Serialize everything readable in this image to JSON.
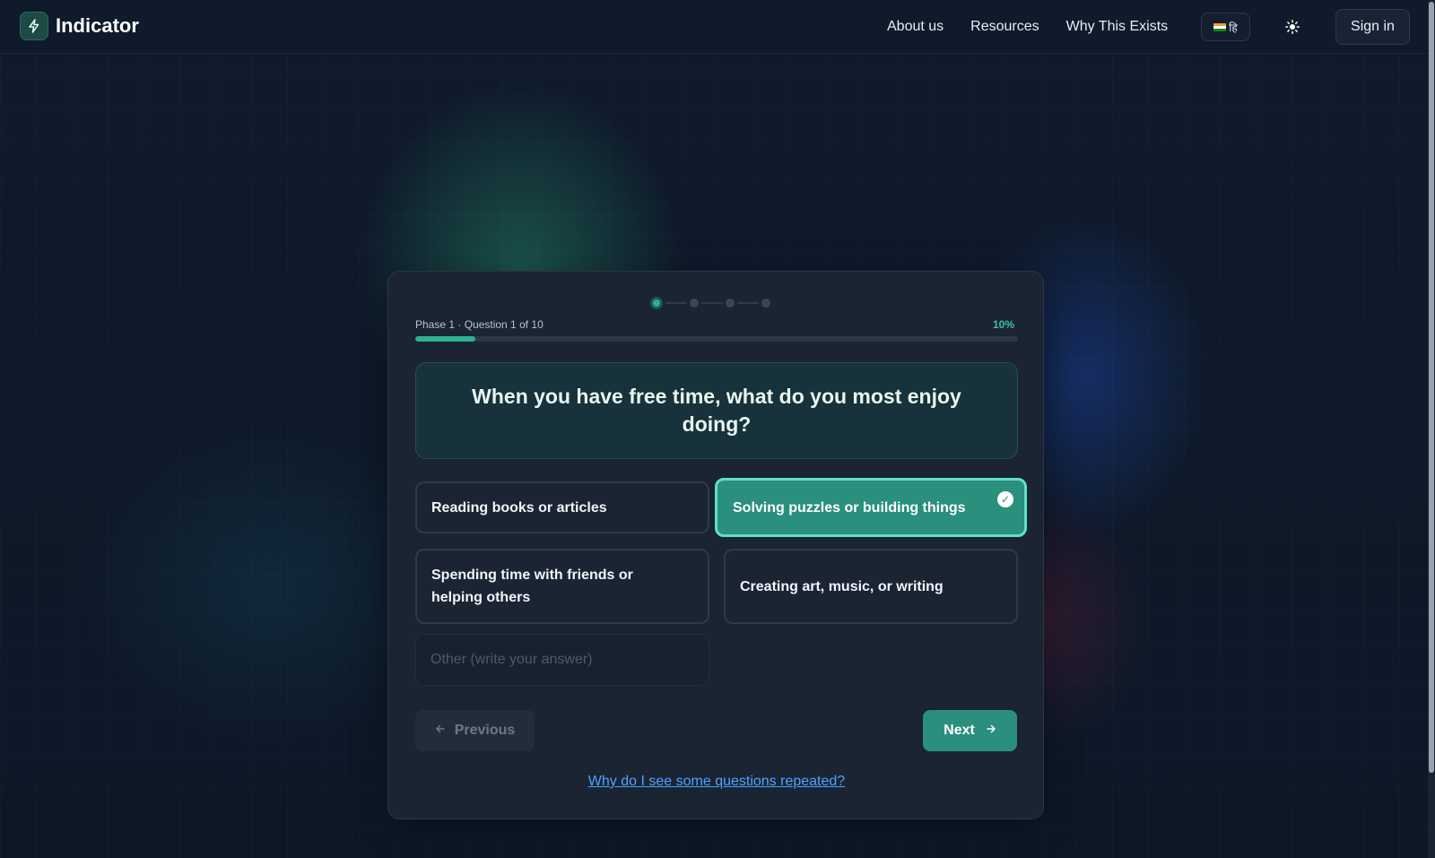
{
  "header": {
    "brand": "Indicator",
    "nav": [
      "About us",
      "Resources",
      "Why This Exists"
    ],
    "language_label": "हि",
    "sign_in_label": "Sign in"
  },
  "quiz": {
    "phase_label": "Phase 1 · Question 1 of 10",
    "percent_label": "10%",
    "progress": 0.1,
    "steps_total": 4,
    "current_step": 1,
    "question": "When you have free time, what do you most enjoy doing?",
    "options": [
      {
        "label": "Reading books or articles",
        "selected": false
      },
      {
        "label": "Solving puzzles or building things",
        "selected": true
      },
      {
        "label": "Spending time with friends or helping others",
        "selected": false
      },
      {
        "label": "Creating art, music, or writing",
        "selected": false
      }
    ],
    "other_placeholder": "Other (write your answer)",
    "previous_label": "Previous",
    "next_label": "Next",
    "help_link": "Why do I see some questions repeated?"
  },
  "colors": {
    "accent": "#2fb08f",
    "selected_bg": "#2a8f7d",
    "link": "#4fa3ff"
  },
  "icons": {
    "logo": "bolt-icon",
    "theme": "sun-icon",
    "check": "check-circle-icon",
    "previous": "arrow-left-icon",
    "next": "arrow-right-icon",
    "language": "india-flag-icon"
  }
}
